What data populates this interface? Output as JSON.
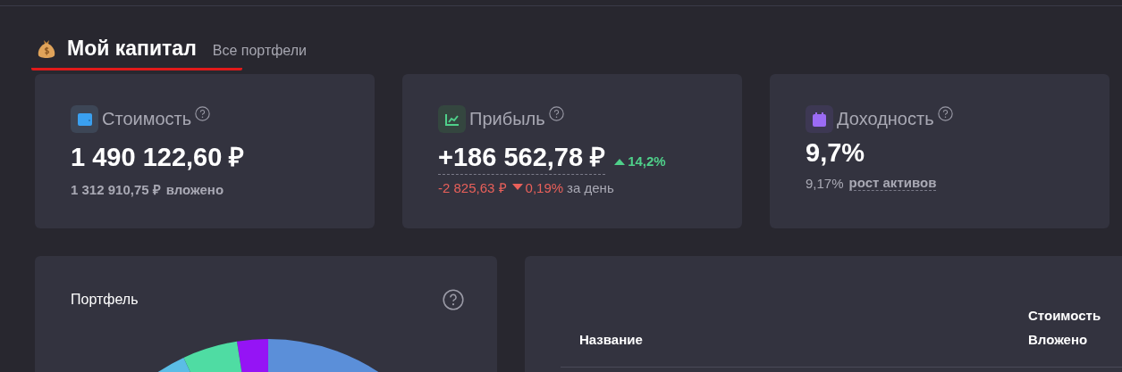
{
  "header": {
    "title": "Мой капитал",
    "subtitle": "Все портфели"
  },
  "metrics": [
    {
      "kind": "value",
      "title": "Стоимость",
      "value": "1 490 122,60 ₽",
      "note_value": "1 312 910,75 ₽",
      "note_label": "вложено"
    },
    {
      "kind": "profit",
      "title": "Прибыль",
      "value": "+186 562,78 ₽",
      "change": "14,2%",
      "change_up": true,
      "day_value": "-2 825,63 ₽",
      "day_change": "0,19%",
      "day_up": false,
      "day_label": "за день"
    },
    {
      "kind": "yield",
      "title": "Доходность",
      "value": "9,7%",
      "note_value": "9,17%",
      "note_label": "рост активов"
    }
  ],
  "portfolio": {
    "title": "Портфель"
  },
  "table": {
    "name_column": "Название",
    "value_columns": [
      "Стоимость",
      "Вложено"
    ]
  }
}
